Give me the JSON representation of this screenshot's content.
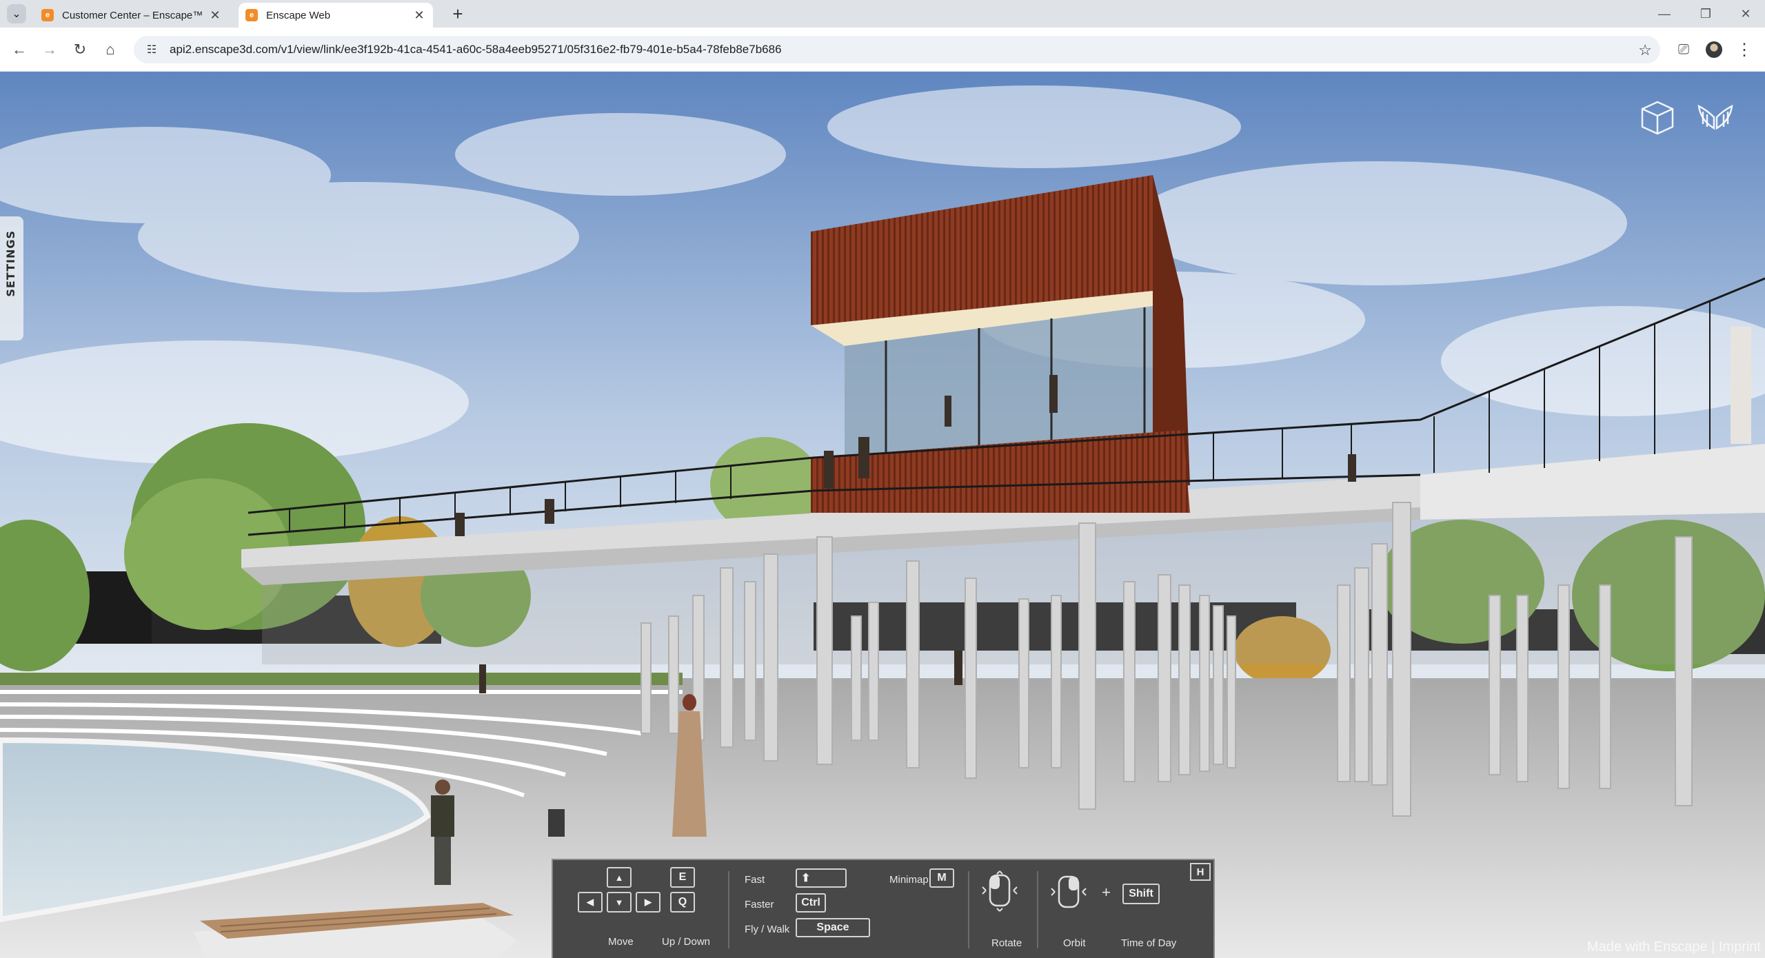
{
  "browser": {
    "tabs": [
      {
        "title": "Customer Center – Enscape™",
        "active": false,
        "favicon": "enscape-icon"
      },
      {
        "title": "Enscape Web",
        "active": true,
        "favicon": "enscape-icon"
      }
    ],
    "url": "api2.enscape3d.com/v1/view/link/ee3f192b-41ca-4541-a60c-58a4eeb95271/05f316e2-fb79-401e-b5a4-78feb8e7b686"
  },
  "viewer": {
    "settings_label": "SETTINGS",
    "watermark": "Made with Enscape | Imprint",
    "top_icons": [
      "cube-icon",
      "angel-wings-icon"
    ]
  },
  "controls": {
    "toggle_key": "H",
    "move_label": "Move",
    "updown_label": "Up / Down",
    "arrow_keys": [
      "▲",
      "◀",
      "▼",
      "▶"
    ],
    "key_e": "E",
    "key_q": "Q",
    "fast_label": "Fast",
    "fast_key": "⬆",
    "faster_label": "Faster",
    "faster_key": "Ctrl",
    "fly_label": "Fly / Walk",
    "fly_key": "Space",
    "minimap_label": "Minimap",
    "minimap_key": "M",
    "rotate_label": "Rotate",
    "orbit_label": "Orbit",
    "plus": "+",
    "shift_key": "Shift",
    "time_label": "Time of Day"
  },
  "colors": {
    "accent_tab_icon": "#f28c28",
    "panel_bg": "#484848",
    "pavilion_wood": "#8b3a22"
  }
}
